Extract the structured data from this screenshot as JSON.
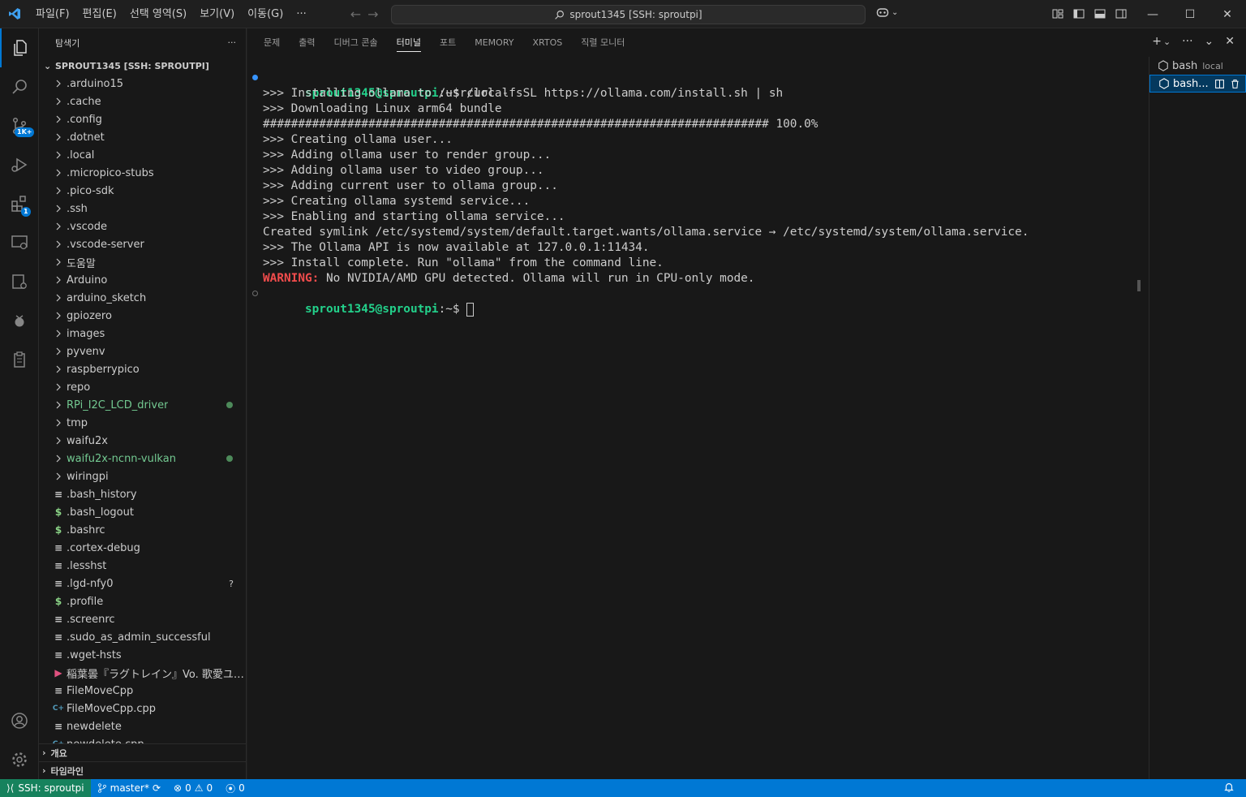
{
  "titlebar": {
    "menu": [
      "파일(F)",
      "편집(E)",
      "선택 영역(S)",
      "보기(V)",
      "이동(G)",
      "···"
    ],
    "command_center": "sprout1345 [SSH: sproutpi]"
  },
  "activity": {
    "scm_badge": "1K+",
    "extensions_badge": "1"
  },
  "sidebar": {
    "title": "탐색기",
    "more": "···",
    "root": "SPROUT1345 [SSH: SPROUTPI]",
    "items": [
      {
        "label": ".arduino15",
        "kind": "folder"
      },
      {
        "label": ".cache",
        "kind": "folder"
      },
      {
        "label": ".config",
        "kind": "folder"
      },
      {
        "label": ".dotnet",
        "kind": "folder"
      },
      {
        "label": ".local",
        "kind": "folder"
      },
      {
        "label": ".micropico-stubs",
        "kind": "folder"
      },
      {
        "label": ".pico-sdk",
        "kind": "folder"
      },
      {
        "label": ".ssh",
        "kind": "folder"
      },
      {
        "label": ".vscode",
        "kind": "folder"
      },
      {
        "label": ".vscode-server",
        "kind": "folder"
      },
      {
        "label": "도움말",
        "kind": "folder"
      },
      {
        "label": "Arduino",
        "kind": "folder"
      },
      {
        "label": "arduino_sketch",
        "kind": "folder"
      },
      {
        "label": "gpiozero",
        "kind": "folder"
      },
      {
        "label": "images",
        "kind": "folder"
      },
      {
        "label": "pyvenv",
        "kind": "folder"
      },
      {
        "label": "raspberrypico",
        "kind": "folder"
      },
      {
        "label": "repo",
        "kind": "folder"
      },
      {
        "label": "RPi_I2C_LCD_driver",
        "kind": "folder",
        "modified": true
      },
      {
        "label": "tmp",
        "kind": "folder"
      },
      {
        "label": "waifu2x",
        "kind": "folder"
      },
      {
        "label": "waifu2x-ncnn-vulkan",
        "kind": "folder",
        "modified": true
      },
      {
        "label": "wiringpi",
        "kind": "folder"
      },
      {
        "label": ".bash_history",
        "kind": "text"
      },
      {
        "label": ".bash_logout",
        "kind": "shell"
      },
      {
        "label": ".bashrc",
        "kind": "shell"
      },
      {
        "label": ".cortex-debug",
        "kind": "text"
      },
      {
        "label": ".lesshst",
        "kind": "text"
      },
      {
        "label": ".lgd-nfy0",
        "kind": "text",
        "status": "?"
      },
      {
        "label": ".profile",
        "kind": "shell"
      },
      {
        "label": ".screenrc",
        "kind": "text"
      },
      {
        "label": ".sudo_as_admin_successful",
        "kind": "text"
      },
      {
        "label": ".wget-hsts",
        "kind": "text"
      },
      {
        "label": "稲葉曇『ラグトレイン』Vo. 歌愛ユキ (...",
        "kind": "media"
      },
      {
        "label": "FileMoveCpp",
        "kind": "text"
      },
      {
        "label": "FileMoveCpp.cpp",
        "kind": "cpp"
      },
      {
        "label": "newdelete",
        "kind": "text"
      },
      {
        "label": "newdelete.cpp",
        "kind": "cpp"
      }
    ],
    "sections": [
      "개요",
      "타임라인"
    ]
  },
  "panel": {
    "tabs": [
      "문제",
      "출력",
      "디버그 콘솔",
      "터미널",
      "포트",
      "MEMORY",
      "XRTOS",
      "직렬 모니터"
    ],
    "active_tab": "터미널"
  },
  "terminal": {
    "prompt": "sprout1345@sproutpi",
    "prompt_suffix": ":~$ ",
    "command": "curl -fsSL https://ollama.com/install.sh | sh",
    "output": [
      ">>> Installing ollama to /usr/local",
      ">>> Downloading Linux arm64 bundle",
      "######################################################################## 100.0%",
      ">>> Creating ollama user...",
      ">>> Adding ollama user to render group...",
      ">>> Adding ollama user to video group...",
      ">>> Adding current user to ollama group...",
      ">>> Creating ollama systemd service...",
      ">>> Enabling and starting ollama service...",
      "Created symlink /etc/systemd/system/default.target.wants/ollama.service → /etc/systemd/system/ollama.service.",
      ">>> The Ollama API is now available at 127.0.0.1:11434.",
      ">>> Install complete. Run \"ollama\" from the command line."
    ],
    "warning_label": "WARNING:",
    "warning_text": " No NVIDIA/AMD GPU detected. Ollama will run in CPU-only mode."
  },
  "terminal_list": {
    "items": [
      {
        "name": "bash",
        "sub": "local"
      },
      {
        "name": "bash...",
        "sub": ""
      }
    ]
  },
  "statusbar": {
    "remote": "SSH: sproutpi",
    "branch": "master*",
    "errors": "0",
    "warnings": "0",
    "ports": "0"
  },
  "colors": {
    "accent": "#0078d4",
    "remote": "#16825d",
    "prompt": "#23d18b",
    "warning": "#f14c4c"
  }
}
